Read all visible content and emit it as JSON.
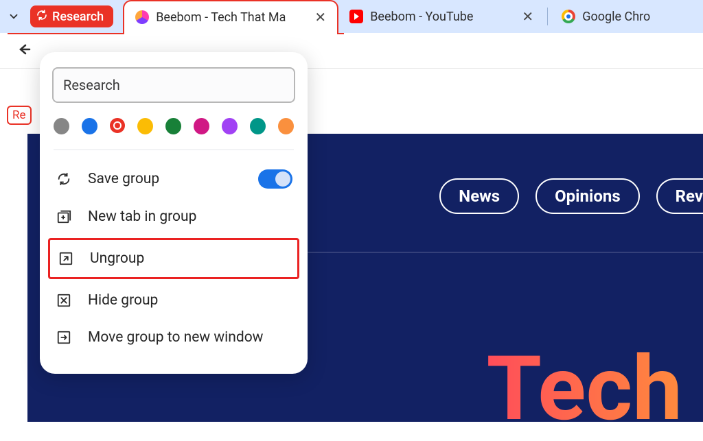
{
  "tabs": {
    "group_chip_label": "Research",
    "tab_active_title": "Beebom - Tech That Ma",
    "tab_youtube_title": "Beebom - YouTube",
    "tab_chrome_title": "Google Chro"
  },
  "badge_under_arrow": "Re",
  "popup": {
    "group_name_value": "Research",
    "colors": {
      "grey": "#868686",
      "blue": "#1a73e8",
      "red": "#ea3226",
      "yellow": "#fbbc05",
      "green": "#188038",
      "pink": "#d01884",
      "purple": "#a142f4",
      "teal": "#009688",
      "orange": "#fa903e",
      "selected": "red"
    },
    "save_group_label": "Save group",
    "save_group_toggle_on": true,
    "new_tab_label": "New tab in group",
    "ungroup_label": "Ungroup",
    "hide_label": "Hide group",
    "move_label": "Move group to new window"
  },
  "hero": {
    "nav_news": "News",
    "nav_opinions": "Opinions",
    "nav_rev": "Rev",
    "big_text": "Tech"
  }
}
